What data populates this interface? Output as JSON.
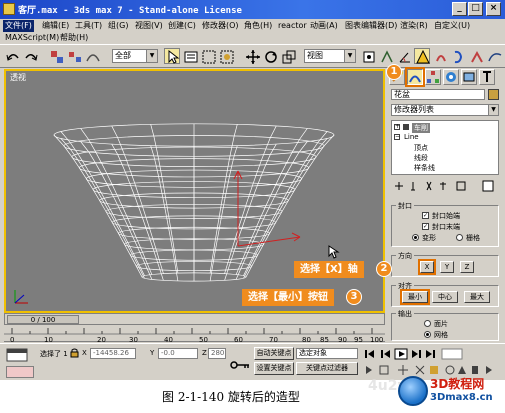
{
  "window": {
    "title": "客厅.max - 3ds max 7 - Stand-alone License",
    "buttons": [
      "_",
      "□",
      "×"
    ]
  },
  "menubar": {
    "items": [
      "文件(F)",
      "编辑(E)",
      "工具(T)",
      "组(G)",
      "视图(V)",
      "创建(C)",
      "修改器(O)",
      "角色(H)",
      "reactor",
      "动画(A)",
      "图表编辑器(D)",
      "渲染(R)",
      "自定义(U)"
    ],
    "row2": [
      "MAXScript(M)",
      "帮助(H)"
    ]
  },
  "toolbar": {
    "selection_filter": "全部",
    "reference_coord": "视图"
  },
  "viewport": {
    "label": "透视"
  },
  "timeline": {
    "slider_text": "0 / 100",
    "ticks": [
      "0",
      "10",
      "20",
      "30",
      "40",
      "50",
      "60",
      "70",
      "80",
      "85",
      "90",
      "95",
      "100"
    ]
  },
  "statusbar": {
    "selected_text": "选择了 1",
    "x_label": "X",
    "x_value": "-14458.26",
    "y_label": "Y",
    "y_value": "-0.0",
    "z_label": "Z",
    "z_value": "280.",
    "auto_key": "自动关键点",
    "set_key": "设置关键点",
    "key_filter": "关键点过滤器",
    "selected_object": "选定对象"
  },
  "command_panel": {
    "object_name": "花盆",
    "modifier_list": "修改器列表",
    "stack": [
      "车削",
      "Line",
      "顶点",
      "线段",
      "样条线"
    ],
    "capping": {
      "title": "封口",
      "cap_start": "封口始端",
      "cap_end": "封口末端",
      "morph": "变形",
      "grid": "栅格"
    },
    "direction": {
      "title": "方向",
      "x": "X",
      "y": "Y",
      "z": "Z"
    },
    "align": {
      "title": "对齐",
      "min": "最小",
      "center": "中心",
      "max": "最大"
    },
    "output": {
      "title": "输出",
      "patch": "面片",
      "mesh": "网格"
    }
  },
  "callouts": {
    "badge1": "1",
    "badge2": "2",
    "badge3": "3",
    "label2": "选择【X】轴",
    "label3": "选择【最小】按钮"
  },
  "caption": "图 2-1-140   旋转后的造型",
  "watermark": {
    "top": "3D教程网",
    "bottom": "3Dmax8.cn",
    "faint": "4u2v"
  }
}
